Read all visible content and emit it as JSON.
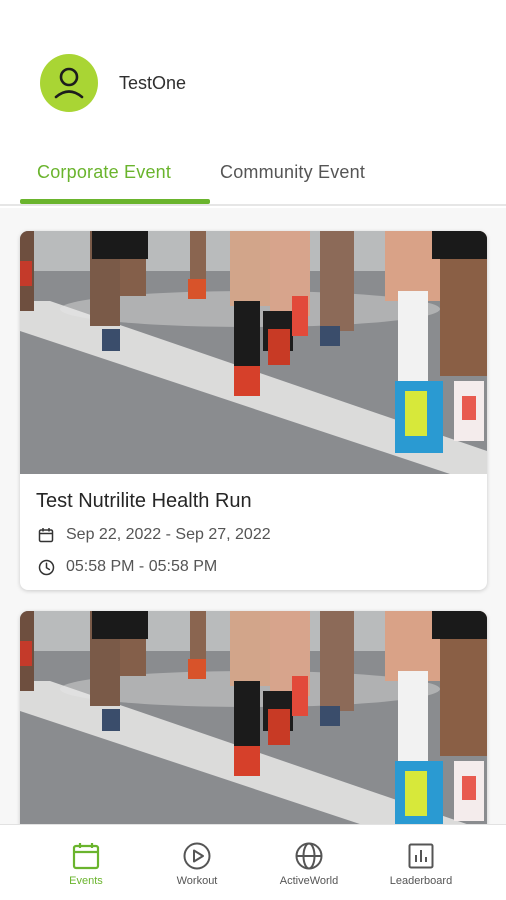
{
  "profile": {
    "username": "TestOne"
  },
  "tabs": [
    {
      "label": "Corporate Event",
      "active": true
    },
    {
      "label": "Community Event",
      "active": false
    }
  ],
  "events": [
    {
      "title": "Test Nutrilite Health Run",
      "date_range": "Sep 22, 2022 - Sep 27, 2022",
      "time_range": "05:58 PM - 05:58 PM"
    },
    {
      "title": "",
      "date_range": "",
      "time_range": ""
    }
  ],
  "bottom_nav": [
    {
      "label": "Events",
      "icon": "calendar-icon",
      "active": true
    },
    {
      "label": "Workout",
      "icon": "play-circle-icon",
      "active": false
    },
    {
      "label": "ActiveWorld",
      "icon": "globe-icon",
      "active": false
    },
    {
      "label": "Leaderboard",
      "icon": "bar-chart-icon",
      "active": false
    }
  ],
  "colors": {
    "accent": "#6ab42d",
    "avatar": "#a9d534",
    "text": "#2b2b2b",
    "muted": "#555555"
  }
}
